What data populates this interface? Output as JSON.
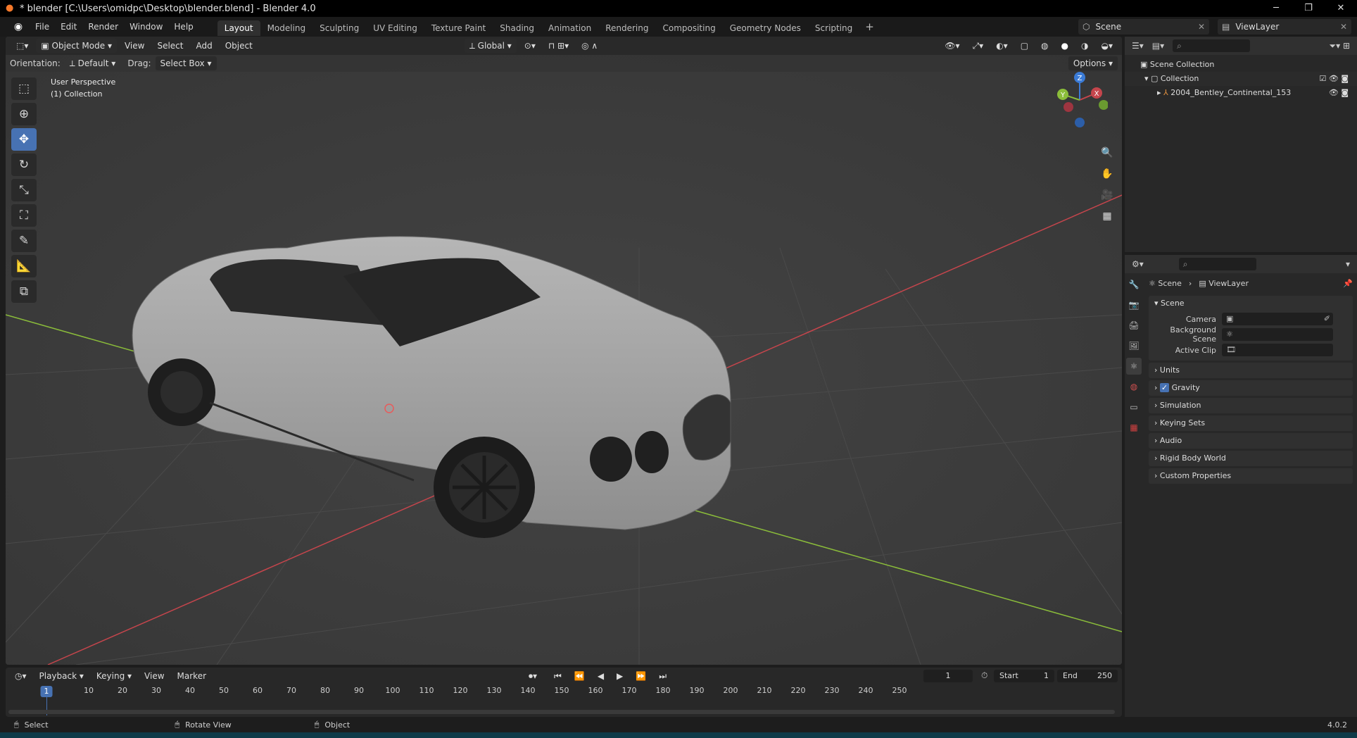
{
  "window": {
    "title": "* blender [C:\\Users\\omidpc\\Desktop\\blender.blend] - Blender 4.0",
    "controls": [
      "─",
      "❐",
      "✕"
    ]
  },
  "menubar": {
    "items": [
      "File",
      "Edit",
      "Render",
      "Window",
      "Help"
    ],
    "workspaces": [
      "Layout",
      "Modeling",
      "Sculpting",
      "UV Editing",
      "Texture Paint",
      "Shading",
      "Animation",
      "Rendering",
      "Compositing",
      "Geometry Nodes",
      "Scripting"
    ],
    "active_workspace": "Layout",
    "scene_name": "Scene",
    "view_layer_name": "ViewLayer"
  },
  "viewport": {
    "mode": "Object Mode",
    "menus": [
      "View",
      "Select",
      "Add",
      "Object"
    ],
    "transform_orientation": "Global",
    "orientation_label": "Orientation:",
    "orientation_value": "Default",
    "drag_label": "Drag:",
    "drag_value": "Select Box",
    "options_label": "Options",
    "info_line1": "User Perspective",
    "info_line2": "(1) Collection",
    "gizmo_axes": {
      "x": "X",
      "y": "Y",
      "z": "Z"
    },
    "colors": {
      "background": "#3a3a3a",
      "axis_x": "#c5454c",
      "axis_y": "#8bbd3a",
      "axis_z": "#3b7bd6",
      "active_tool": "#4772b3"
    }
  },
  "outliner": {
    "root": "Scene Collection",
    "collection": "Collection",
    "object": "2004_Bentley_Continental_153"
  },
  "properties": {
    "breadcrumb_scene": "Scene",
    "breadcrumb_layer": "ViewLayer",
    "panel_title": "Scene",
    "fields": [
      {
        "label": "Camera",
        "value": ""
      },
      {
        "label": "Background Scene",
        "value": ""
      },
      {
        "label": "Active Clip",
        "value": ""
      }
    ],
    "collapsed_panels": [
      "Units",
      "Gravity",
      "Simulation",
      "Keying Sets",
      "Audio",
      "Rigid Body World",
      "Custom Properties"
    ],
    "gravity_checked": true
  },
  "timeline": {
    "menus": [
      "Playback",
      "Keying",
      "View",
      "Marker"
    ],
    "current_frame": "1",
    "start_label": "Start",
    "start_value": "1",
    "end_label": "End",
    "end_value": "250",
    "ticks": [
      "10",
      "20",
      "30",
      "40",
      "50",
      "60",
      "70",
      "80",
      "90",
      "100",
      "110",
      "120",
      "130",
      "140",
      "150",
      "160",
      "170",
      "180",
      "190",
      "200",
      "210",
      "220",
      "230",
      "240",
      "250"
    ]
  },
  "statusbar": {
    "select": "Select",
    "rotate": "Rotate View",
    "object": "Object",
    "version": "4.0.2"
  }
}
